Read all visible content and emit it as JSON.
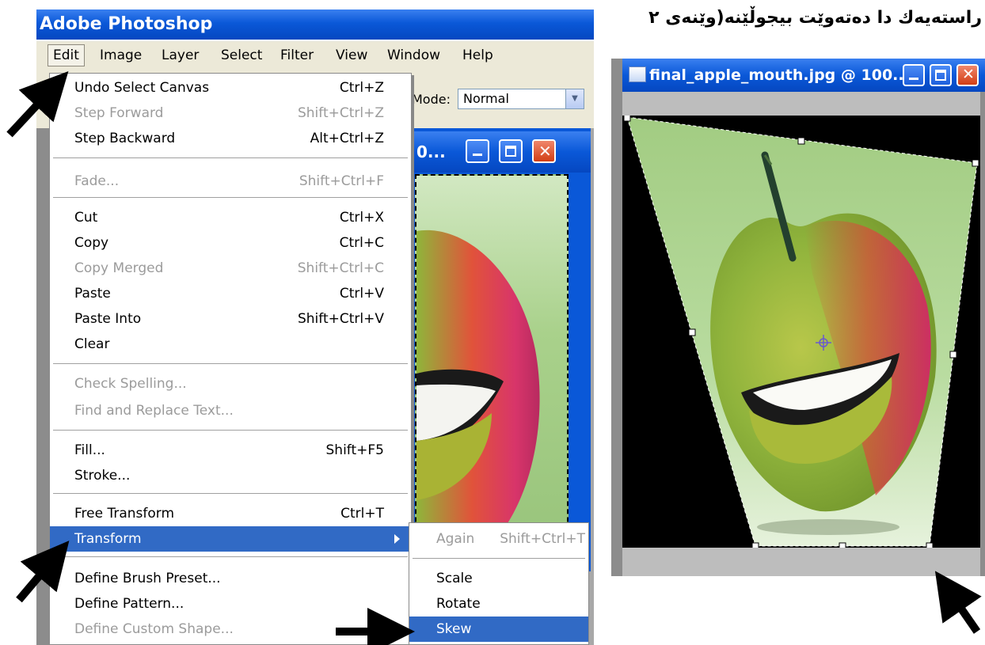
{
  "app": {
    "title": "Adobe Photoshop"
  },
  "caption_rtl": "راستەیەك دا دەتەوێت بیجوڵێنە(وێنەی ٢",
  "menubar": {
    "items": [
      {
        "label": "Edit",
        "active": true
      },
      {
        "label": "Image"
      },
      {
        "label": "Layer"
      },
      {
        "label": "Select"
      },
      {
        "label": "Filter"
      },
      {
        "label": "View"
      },
      {
        "label": "Window"
      },
      {
        "label": "Help"
      }
    ]
  },
  "options_bar": {
    "mode_label": "Mode:",
    "mode_value": "Normal"
  },
  "doc_window_bg": {
    "title": "0..."
  },
  "edit_menu": {
    "items": [
      {
        "label": "Undo Select Canvas",
        "shortcut": "Ctrl+Z",
        "disabled": false
      },
      {
        "label": "Step Forward",
        "shortcut": "Shift+Ctrl+Z",
        "disabled": true
      },
      {
        "label": "Step Backward",
        "shortcut": "Alt+Ctrl+Z",
        "disabled": false
      },
      {
        "label": "Fade...",
        "shortcut": "Shift+Ctrl+F",
        "disabled": true
      },
      {
        "label": "Cut",
        "shortcut": "Ctrl+X",
        "disabled": false
      },
      {
        "label": "Copy",
        "shortcut": "Ctrl+C",
        "disabled": false
      },
      {
        "label": "Copy Merged",
        "shortcut": "Shift+Ctrl+C",
        "disabled": true
      },
      {
        "label": "Paste",
        "shortcut": "Ctrl+V",
        "disabled": false
      },
      {
        "label": "Paste Into",
        "shortcut": "Shift+Ctrl+V",
        "disabled": false
      },
      {
        "label": "Clear",
        "shortcut": "",
        "disabled": false
      },
      {
        "label": "Check Spelling...",
        "shortcut": "",
        "disabled": true
      },
      {
        "label": "Find and Replace Text...",
        "shortcut": "",
        "disabled": true
      },
      {
        "label": "Fill...",
        "shortcut": "Shift+F5",
        "disabled": false
      },
      {
        "label": "Stroke...",
        "shortcut": "",
        "disabled": false
      },
      {
        "label": "Free Transform",
        "shortcut": "Ctrl+T",
        "disabled": false
      },
      {
        "label": "Transform",
        "shortcut": "",
        "disabled": false,
        "highlighted": true,
        "submenu": true
      },
      {
        "label": "Define Brush Preset...",
        "shortcut": "",
        "disabled": false
      },
      {
        "label": "Define Pattern...",
        "shortcut": "",
        "disabled": false
      },
      {
        "label": "Define Custom Shape...",
        "shortcut": "",
        "disabled": true
      }
    ]
  },
  "transform_submenu": {
    "items": [
      {
        "label": "Again",
        "shortcut": "Shift+Ctrl+T",
        "disabled": true
      },
      {
        "label": "Scale",
        "shortcut": "",
        "disabled": false
      },
      {
        "label": "Rotate",
        "shortcut": "",
        "disabled": false
      },
      {
        "label": "Skew",
        "shortcut": "",
        "disabled": false,
        "highlighted": true
      }
    ]
  },
  "right_window": {
    "title": "final_apple_mouth.jpg @ 100..."
  },
  "colors": {
    "xp_blue": "#0a58d8",
    "menu_highlight": "#316ac5",
    "canvas_green": "#a9d18b"
  }
}
